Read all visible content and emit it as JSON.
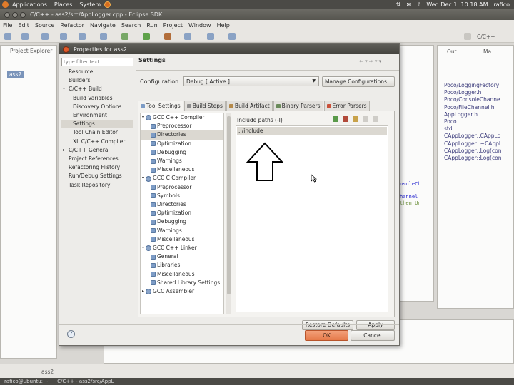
{
  "gnome_panel": {
    "menus": [
      "Applications",
      "Places",
      "System"
    ],
    "clock": "Wed Dec 1, 10:18 AM",
    "user": "rafico"
  },
  "eclipse": {
    "title": "C/C++ - ass2/src/AppLogger.cpp - Eclipse SDK",
    "menu": [
      "File",
      "Edit",
      "Source",
      "Refactor",
      "Navigate",
      "Search",
      "Run",
      "Project",
      "Window",
      "Help"
    ],
    "left_view_tab": "Project Explorer",
    "project_item": "ass2",
    "perspective_tab": "C/C++",
    "outline_tabs": [
      "Out",
      "Ma"
    ],
    "outline_items": [
      "Poco/LoggingFactory",
      "Poco/Logger.h",
      "Poco/ConsoleChanne",
      "Poco/FileChannel.h",
      "AppLogger.h",
      "Poco",
      "std",
      "CAppLogger::CAppLo",
      "CAppLogger::~CAppL",
      "CAppLogger::Log(con",
      "CAppLogger::Log(con"
    ],
    "code_fragments": [
      "nsoleCh",
      "hannel",
      "then Un"
    ],
    "status_project": "ass2",
    "taskbar_items": [
      "rafico@ubuntu: ~",
      "C/C++ - ass2/src/AppL"
    ]
  },
  "dialog": {
    "title": "Properties for ass2",
    "filter_placeholder": "type filter text",
    "nav_items": [
      {
        "label": "Resource",
        "indent": 0
      },
      {
        "label": "Builders",
        "indent": 0
      },
      {
        "label": "C/C++ Build",
        "indent": 0,
        "expanded": true
      },
      {
        "label": "Build Variables",
        "indent": 1
      },
      {
        "label": "Discovery Options",
        "indent": 1
      },
      {
        "label": "Environment",
        "indent": 1
      },
      {
        "label": "Settings",
        "indent": 1,
        "selected": true
      },
      {
        "label": "Tool Chain Editor",
        "indent": 1
      },
      {
        "label": "XL C/C++ Compiler",
        "indent": 1
      },
      {
        "label": "C/C++ General",
        "indent": 0,
        "collapsed": true
      },
      {
        "label": "Project References",
        "indent": 0
      },
      {
        "label": "Refactoring History",
        "indent": 0
      },
      {
        "label": "Run/Debug Settings",
        "indent": 0
      },
      {
        "label": "Task Repository",
        "indent": 0
      }
    ],
    "settings_header": "Settings",
    "configuration_label": "Configuration:",
    "configuration_value": "Debug [ Active ]",
    "manage_button": "Manage Configurations...",
    "tabs": [
      "Tool Settings",
      "Build Steps",
      "Build Artifact",
      "Binary Parsers",
      "Error Parsers"
    ],
    "tool_tree": [
      {
        "label": "GCC C++ Compiler",
        "group": true
      },
      {
        "label": "Preprocessor"
      },
      {
        "label": "Directories",
        "selected": true
      },
      {
        "label": "Optimization"
      },
      {
        "label": "Debugging"
      },
      {
        "label": "Warnings"
      },
      {
        "label": "Miscellaneous"
      },
      {
        "label": "GCC C Compiler",
        "group": true
      },
      {
        "label": "Preprocessor"
      },
      {
        "label": "Symbols"
      },
      {
        "label": "Directories"
      },
      {
        "label": "Optimization"
      },
      {
        "label": "Debugging"
      },
      {
        "label": "Warnings"
      },
      {
        "label": "Miscellaneous"
      },
      {
        "label": "GCC C++ Linker",
        "group": true
      },
      {
        "label": "General"
      },
      {
        "label": "Libraries"
      },
      {
        "label": "Miscellaneous"
      },
      {
        "label": "Shared Library Settings"
      },
      {
        "label": "GCC Assembler",
        "group": true
      }
    ],
    "include_label": "Include paths (-I)",
    "include_value": "../include",
    "restore_button": "Restore Defaults",
    "apply_button": "Apply",
    "ok_button": "OK",
    "cancel_button": "Cancel",
    "help_glyph": "?"
  }
}
